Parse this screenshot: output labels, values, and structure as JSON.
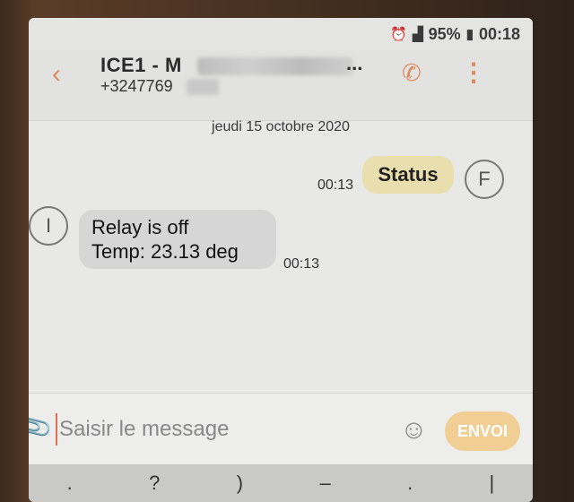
{
  "status_bar": {
    "battery": "95%",
    "time": "00:18",
    "icons": [
      "alarm-icon",
      "signal-icon",
      "battery-icon"
    ]
  },
  "header": {
    "contact_name": "ICE1 - M",
    "name_ellipsis": "...",
    "contact_number": "+3247769",
    "icons": [
      "back-arrow-icon",
      "phone-icon",
      "more-vert-icon"
    ]
  },
  "conversation": {
    "date": "jeudi 15 octobre 2020",
    "messages": [
      {
        "direction": "out",
        "avatar": "F",
        "lines": [
          "Status"
        ],
        "time": "00:13"
      },
      {
        "direction": "in",
        "avatar": "I",
        "lines": [
          "Relay is off",
          "Temp: 23.13 deg"
        ],
        "time": "00:13"
      }
    ]
  },
  "composer": {
    "placeholder": "Saisir le message",
    "send_label": "ENVOI"
  },
  "keyboard": {
    "keys": [
      ".",
      "?",
      ")",
      "–",
      ".",
      "|"
    ]
  },
  "colors": {
    "accent": "#e08a5a",
    "outgoing_bubble": "#e9dfae",
    "incoming_bubble": "#d6d6d6",
    "send_button": "#f1ce93"
  }
}
